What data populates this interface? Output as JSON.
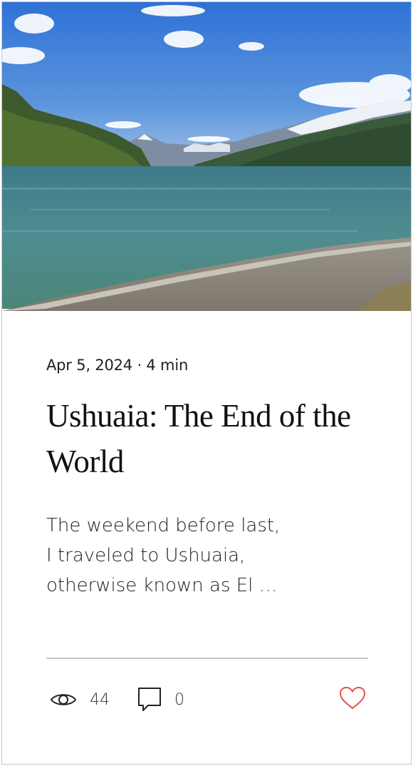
{
  "post": {
    "date": "Apr 5, 2024",
    "separator": "·",
    "read_time": "4 min",
    "title": "Ushuaia: The End of the World",
    "excerpt_lines": [
      "The weekend before last,",
      "I traveled to Ushuaia,",
      "otherwise known as El …"
    ]
  },
  "stats": {
    "views": "44",
    "comments": "0",
    "view_icon": "eye-icon",
    "comment_icon": "comment-icon",
    "like_icon": "heart-icon"
  },
  "colors": {
    "like": "#e0514f",
    "divider": "#c4c4c4",
    "text": "#222222"
  }
}
